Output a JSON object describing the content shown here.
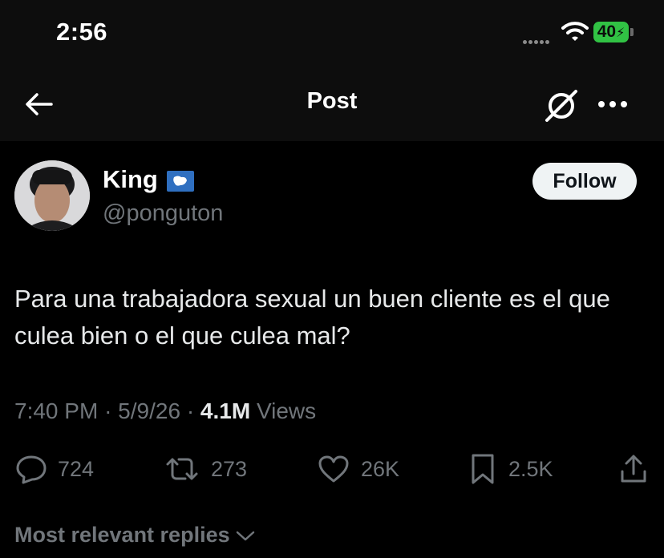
{
  "status_bar": {
    "time": "2:56",
    "battery": "40"
  },
  "header": {
    "title": "Post"
  },
  "author": {
    "name": "King",
    "handle": "@ponguton",
    "follow_label": "Follow"
  },
  "post": {
    "text": "Para una trabajadora sexual un buen cliente es el que culea bien o el que culea mal?",
    "time": "7:40 PM",
    "date": "5/9/26",
    "views_count": "4.1M",
    "views_label": "Views"
  },
  "actions": {
    "replies": "724",
    "reposts": "273",
    "likes": "26K",
    "bookmarks": "2.5K"
  },
  "replies_sort": {
    "label": "Most relevant replies"
  },
  "colors": {
    "background": "#000000",
    "header_bg": "#0d0d0d",
    "text": "#e7e9ea",
    "secondary": "#71767b",
    "battery": "#31c244"
  }
}
